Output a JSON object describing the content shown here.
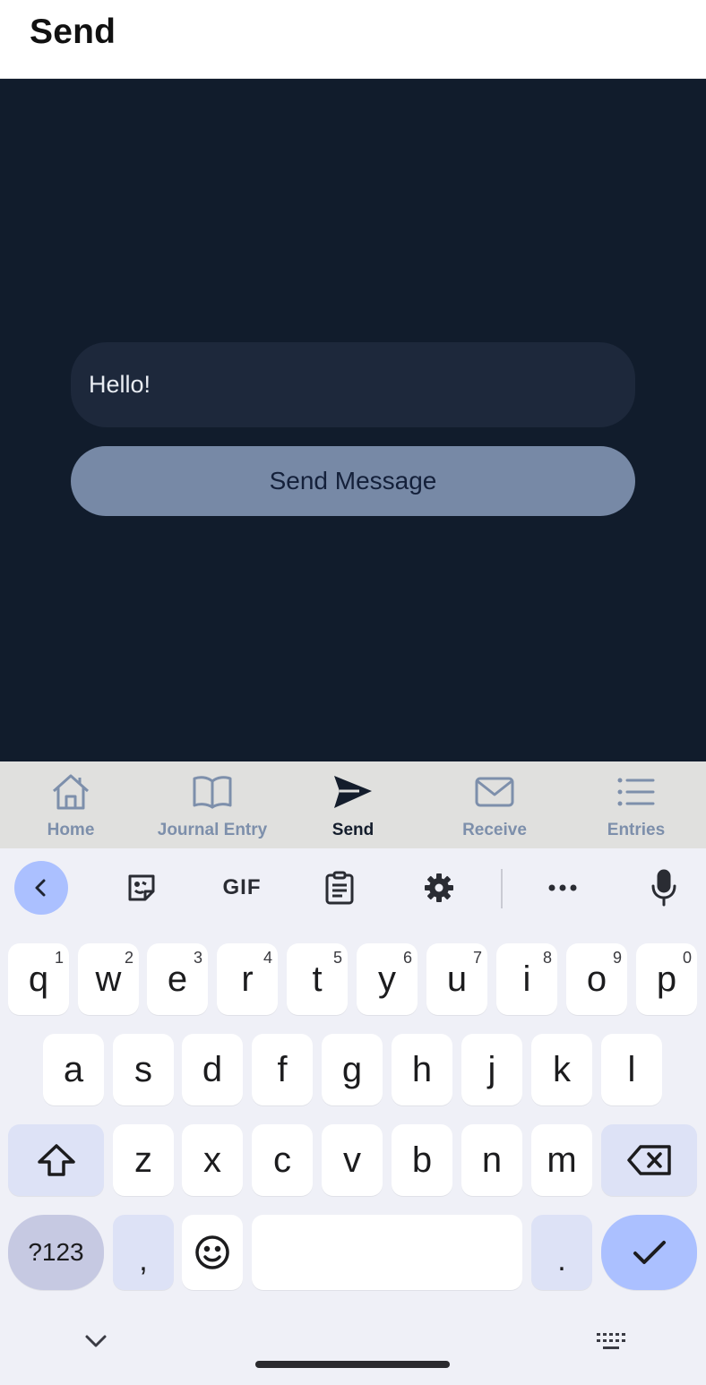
{
  "header": {
    "title": "Send"
  },
  "message": {
    "value": "Hello!",
    "placeholder": ""
  },
  "send_button": {
    "label": "Send Message"
  },
  "tabs": [
    {
      "label": "Home",
      "icon": "home-icon",
      "active": false
    },
    {
      "label": "Journal Entry",
      "icon": "book-icon",
      "active": false
    },
    {
      "label": "Send",
      "icon": "send-icon",
      "active": true
    },
    {
      "label": "Receive",
      "icon": "mail-icon",
      "active": false
    },
    {
      "label": "Entries",
      "icon": "list-icon",
      "active": false
    }
  ],
  "keyboard": {
    "toolbar": {
      "gif_label": "GIF",
      "icons": [
        "back-chevron-icon",
        "sticker-icon",
        "gif-icon",
        "clipboard-icon",
        "gear-icon",
        "more-icon",
        "microphone-icon"
      ]
    },
    "row1": [
      {
        "key": "q",
        "hint": "1"
      },
      {
        "key": "w",
        "hint": "2"
      },
      {
        "key": "e",
        "hint": "3"
      },
      {
        "key": "r",
        "hint": "4"
      },
      {
        "key": "t",
        "hint": "5"
      },
      {
        "key": "y",
        "hint": "6"
      },
      {
        "key": "u",
        "hint": "7"
      },
      {
        "key": "i",
        "hint": "8"
      },
      {
        "key": "o",
        "hint": "9"
      },
      {
        "key": "p",
        "hint": "0"
      }
    ],
    "row2": [
      "a",
      "s",
      "d",
      "f",
      "g",
      "h",
      "j",
      "k",
      "l"
    ],
    "row3": [
      "z",
      "x",
      "c",
      "v",
      "b",
      "n",
      "m"
    ],
    "symbols_label": "?123",
    "comma": ",",
    "period": ".",
    "colors": {
      "accent": "#abc0ff",
      "modifier": "#dde2f6",
      "background": "#eff0f7"
    }
  },
  "colors": {
    "content_bg": "#111c2c",
    "input_bg": "#1d283b",
    "button_bg": "#7789a6",
    "tabbar_bg": "#e0e0de",
    "tab_inactive": "#7d8fab",
    "tab_active": "#141d2c"
  }
}
